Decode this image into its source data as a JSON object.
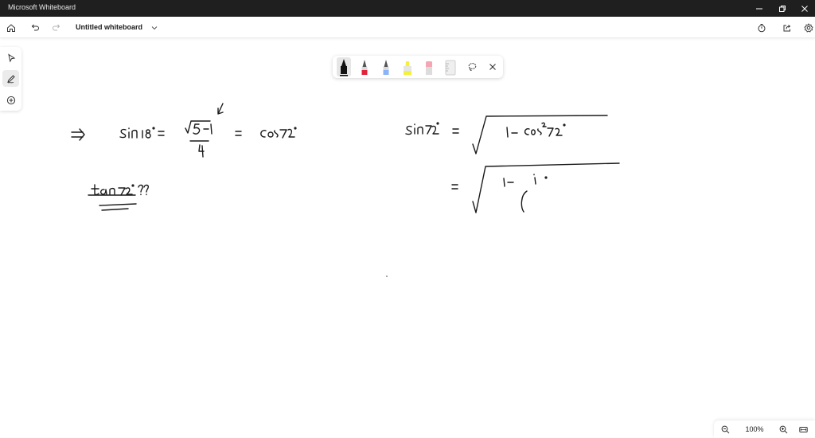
{
  "window": {
    "title": "Microsoft Whiteboard",
    "controls": [
      "minimize-icon",
      "restore-icon",
      "close-icon"
    ]
  },
  "command_bar": {
    "board_name": "Untitled whiteboard",
    "left_icons": [
      "home-icon",
      "undo-icon",
      "redo-icon"
    ],
    "right_icons": [
      "timer-icon",
      "share-icon",
      "settings-icon"
    ]
  },
  "left_toolbar": {
    "tools": [
      "select-icon",
      "inking-icon",
      "add-icon"
    ],
    "active": "inking-icon"
  },
  "pen_tray": {
    "pens": [
      {
        "name": "black-pen",
        "color": "#1b1b1b"
      },
      {
        "name": "red-pen",
        "color": "#e0243b"
      },
      {
        "name": "blue-pen",
        "color": "#8ab4f8"
      },
      {
        "name": "yellow-highlighter",
        "color": "#f5f03c"
      },
      {
        "name": "eraser",
        "color": "#f4a6b3"
      },
      {
        "name": "ruler",
        "color": "#cfcfcf"
      }
    ],
    "active_pen": "black-pen",
    "actions": [
      "lasso-icon",
      "close-icon"
    ]
  },
  "canvas": {
    "ink_color": "#1a1a1a",
    "handwritten_math": [
      "⇒ sin 18° = (√5 − 1)/4 = cos 72°",
      "tan 72° ??",
      "sin 72° = √(1 − cos² 72°)",
      "= √(1 − (…"
    ]
  },
  "zoom_bar": {
    "zoom_level": "100%",
    "icons": [
      "zoom-out-icon",
      "zoom-in-icon",
      "fit-to-screen-icon"
    ]
  }
}
